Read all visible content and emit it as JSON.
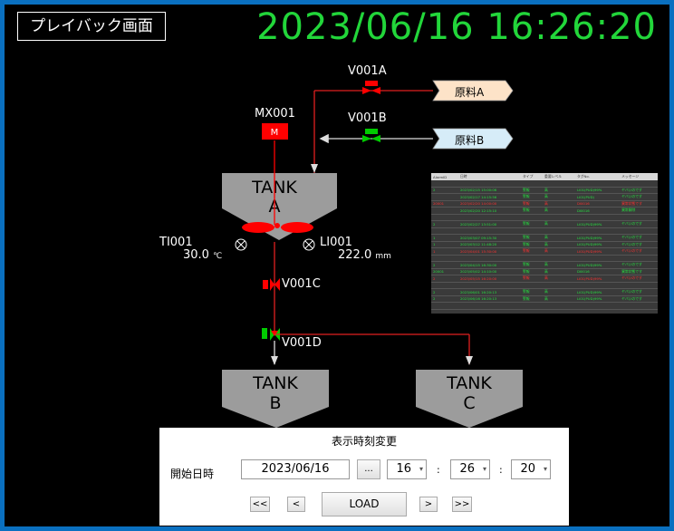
{
  "header": {
    "title": "プレイバック画面",
    "datetime": "2023/06/16 16:26:20"
  },
  "colors": {
    "clock": "#22d63a",
    "valve_closed": "#ff0000",
    "valve_open": "#00cc00",
    "frame": "#0a70c0"
  },
  "process": {
    "mixer": {
      "tag": "MX001",
      "label": "M"
    },
    "tank_a": {
      "line1": "TANK",
      "line2": "A"
    },
    "tank_b": {
      "line1": "TANK",
      "line2": "B"
    },
    "tank_c": {
      "line1": "TANK",
      "line2": "C"
    },
    "valves": {
      "v001a": {
        "tag": "V001A",
        "state": "closed"
      },
      "v001b": {
        "tag": "V001B",
        "state": "open"
      },
      "v001c": {
        "tag": "V001C",
        "state": "closed"
      },
      "v001d": {
        "tag": "V001D",
        "state": "open"
      }
    },
    "materials": {
      "a": "原料A",
      "b": "原料B"
    },
    "sensors": {
      "ti001": {
        "tag": "TI001",
        "value": "30.0",
        "unit": "℃"
      },
      "li001": {
        "tag": "LI001",
        "value": "222.0",
        "unit": "mm"
      }
    }
  },
  "alarm_table": {
    "headers": [
      "AlarmID",
      "日時",
      "タイプ",
      "重要レベル",
      "タグNo.",
      "メッセージ"
    ],
    "rows": [
      {
        "id": "",
        "time": "",
        "type": "",
        "level": "",
        "tag": "",
        "msg": "",
        "tone": "r"
      },
      {
        "id": "2",
        "time": "2023/02/15 15:00:06",
        "type": "警報",
        "level": "高",
        "tag": "LI01(PUD)99%",
        "msg": "ヤバいのです",
        "tone": "g"
      },
      {
        "id": "",
        "time": "2023/02/17 14:15:56",
        "type": "警報",
        "level": "高",
        "tag": "LI01(PUD)",
        "msg": "ヤバいのです",
        "tone": "g"
      },
      {
        "id": "20001",
        "time": "2023/02/20 14:00:00",
        "type": "警報",
        "level": "高",
        "tag": "DI0016",
        "msg": "異常状態です",
        "tone": "r"
      },
      {
        "id": "",
        "time": "2023/02/20 12:15:10",
        "type": "警報",
        "level": "高",
        "tag": "DI0016",
        "msg": "異常解除",
        "tone": "g"
      },
      {
        "id": "",
        "time": "",
        "type": "",
        "level": "",
        "tag": "",
        "msg": "",
        "tone": "w"
      },
      {
        "id": "2",
        "time": "2023/02/27 13:51:00",
        "type": "警報",
        "level": "高",
        "tag": "LI01(PUD)99%",
        "msg": "ヤバいのです",
        "tone": "g"
      },
      {
        "id": "",
        "time": "",
        "type": "",
        "level": "",
        "tag": "",
        "msg": "",
        "tone": "w"
      },
      {
        "id": "1",
        "time": "2023/03/07 09:15:30",
        "type": "警報",
        "level": "高",
        "tag": "LI01(PUD)99%",
        "msg": "ヤバいのです",
        "tone": "g"
      },
      {
        "id": "1",
        "time": "2023/03/12 11:48:20",
        "type": "警報",
        "level": "高",
        "tag": "LI01(PUD)99%",
        "msg": "ヤバいのです",
        "tone": "g"
      },
      {
        "id": "1",
        "time": "2023/04/01 15:30:00",
        "type": "警報",
        "level": "高",
        "tag": "LI01(PUD)99%",
        "msg": "ヤバいのです",
        "tone": "r"
      },
      {
        "id": "",
        "time": "",
        "type": "",
        "level": "",
        "tag": "",
        "msg": "",
        "tone": "w"
      },
      {
        "id": "2",
        "time": "2023/04/15 16:30:00",
        "type": "警報",
        "level": "高",
        "tag": "LI01(PUD)99%",
        "msg": "ヤバいのです",
        "tone": "g"
      },
      {
        "id": "20001",
        "time": "2023/05/02 14:10:00",
        "type": "警報",
        "level": "高",
        "tag": "DI0016",
        "msg": "異常状態です",
        "tone": "g"
      },
      {
        "id": "2",
        "time": "2023/05/15 16:20:00",
        "type": "警報",
        "level": "高",
        "tag": "LI01(PUD)99%",
        "msg": "ヤバいのです",
        "tone": "r"
      },
      {
        "id": "",
        "time": "",
        "type": "",
        "level": "",
        "tag": "",
        "msg": "",
        "tone": "w"
      },
      {
        "id": "2",
        "time": "2023/06/01 16:20:13",
        "type": "警報",
        "level": "高",
        "tag": "LI01(PUD)99%",
        "msg": "ヤバいのです",
        "tone": "g"
      },
      {
        "id": "2",
        "time": "2023/06/16 16:20:13",
        "type": "警報",
        "level": "高",
        "tag": "LI01(PUD)99%",
        "msg": "ヤバいのです",
        "tone": "g"
      },
      {
        "id": "",
        "time": "",
        "type": "",
        "level": "",
        "tag": "",
        "msg": "",
        "tone": "w"
      }
    ]
  },
  "panel": {
    "title": "表示時刻変更",
    "start_label": "開始日時",
    "date": "2023/06/16",
    "browse_label": "...",
    "hour": "16",
    "minute": "26",
    "second": "20",
    "colon": ":",
    "dropdown_arrow": "▾",
    "btn_first": "<<",
    "btn_prev": "<",
    "btn_load": "LOAD",
    "btn_next": ">",
    "btn_last": ">>"
  }
}
